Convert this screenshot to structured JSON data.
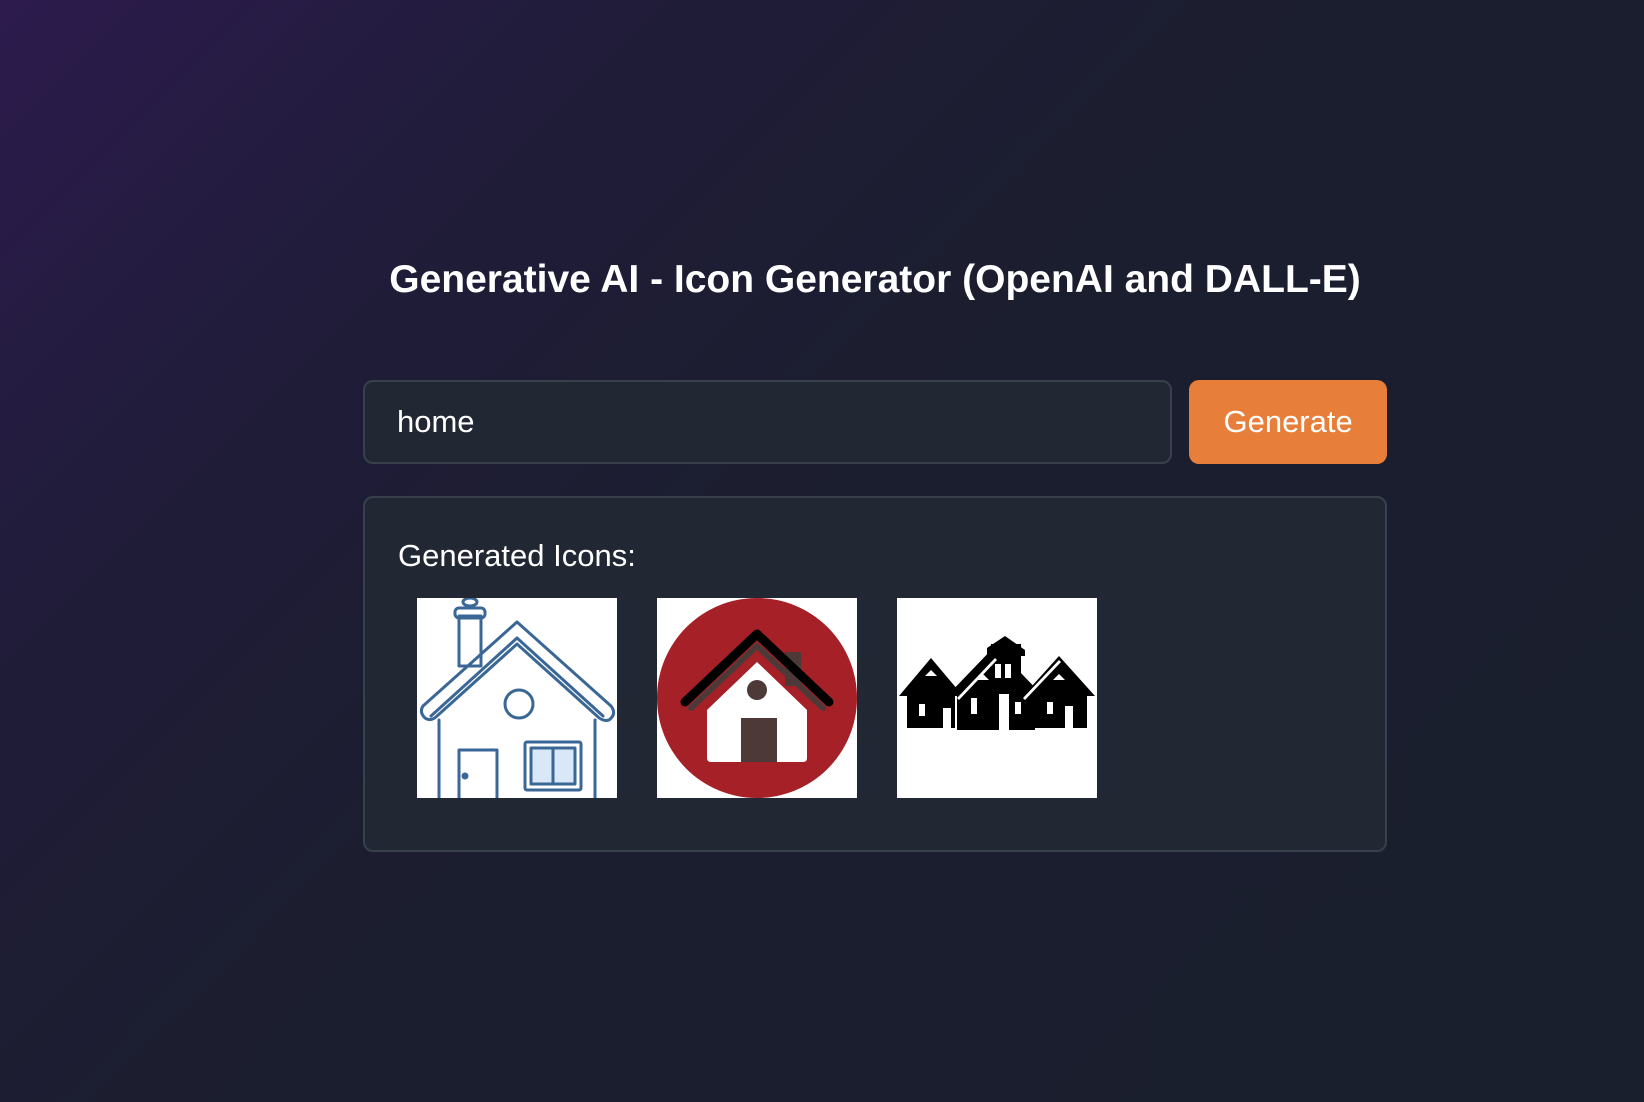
{
  "header": {
    "title": "Generative AI - Icon Generator (OpenAI and DALL-E)"
  },
  "prompt": {
    "value": "home",
    "button_label": "Generate"
  },
  "results": {
    "label": "Generated Icons:",
    "icons": [
      {
        "name": "outline-house-icon",
        "accent": "#3a6796"
      },
      {
        "name": "red-circle-house-icon",
        "accent": "#a52027"
      },
      {
        "name": "black-houses-silhouette-icon",
        "accent": "#000000"
      }
    ]
  },
  "colors": {
    "button": "#e77e39",
    "panel": "#212733",
    "border": "#39404d"
  }
}
